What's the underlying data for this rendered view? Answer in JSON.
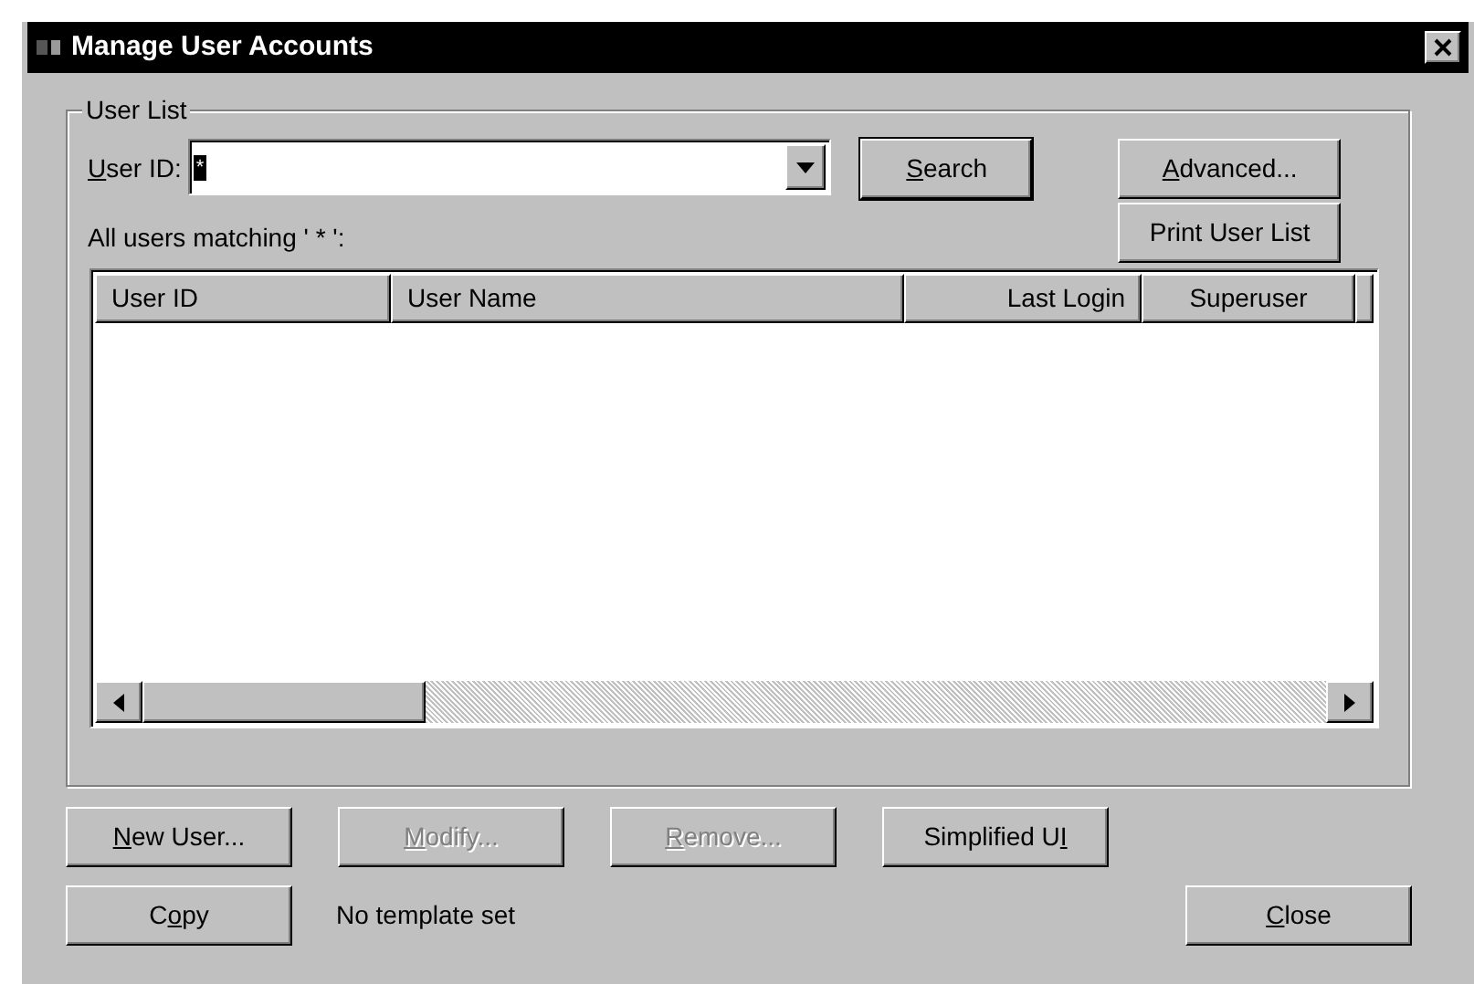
{
  "window": {
    "title": "Manage User Accounts"
  },
  "group": {
    "title": "User List"
  },
  "user_id_field": {
    "label": {
      "key": "U",
      "after": "ser ID:"
    },
    "value": "*"
  },
  "buttons_top": [
    {
      "label": {
        "key": "S",
        "after": "earch"
      },
      "default": true
    },
    {
      "label": {
        "key": "A",
        "after": "dvanced..."
      },
      "default": false
    },
    {
      "label": {
        "before": "Print User List"
      },
      "default": false
    }
  ],
  "match_text": "All users matching ' * ':",
  "table": {
    "columns": [
      "User ID",
      "User Name",
      "Last Login",
      "Superuser"
    ]
  },
  "buttons_bottom": [
    {
      "label": {
        "key": "N",
        "after": "ew User..."
      },
      "disabled": false
    },
    {
      "label": {
        "key": "M",
        "after": "odify..."
      },
      "disabled": true
    },
    {
      "label": {
        "key": "R",
        "after": "emove..."
      },
      "disabled": true
    },
    {
      "label": {
        "before": "Simplified U",
        "key": "I"
      },
      "disabled": false
    }
  ],
  "copy_button": {
    "label": {
      "before": "C",
      "key": "o",
      "after": "py"
    }
  },
  "template_text": "No template set",
  "close_button": {
    "label": {
      "key": "C",
      "after": "lose"
    }
  }
}
